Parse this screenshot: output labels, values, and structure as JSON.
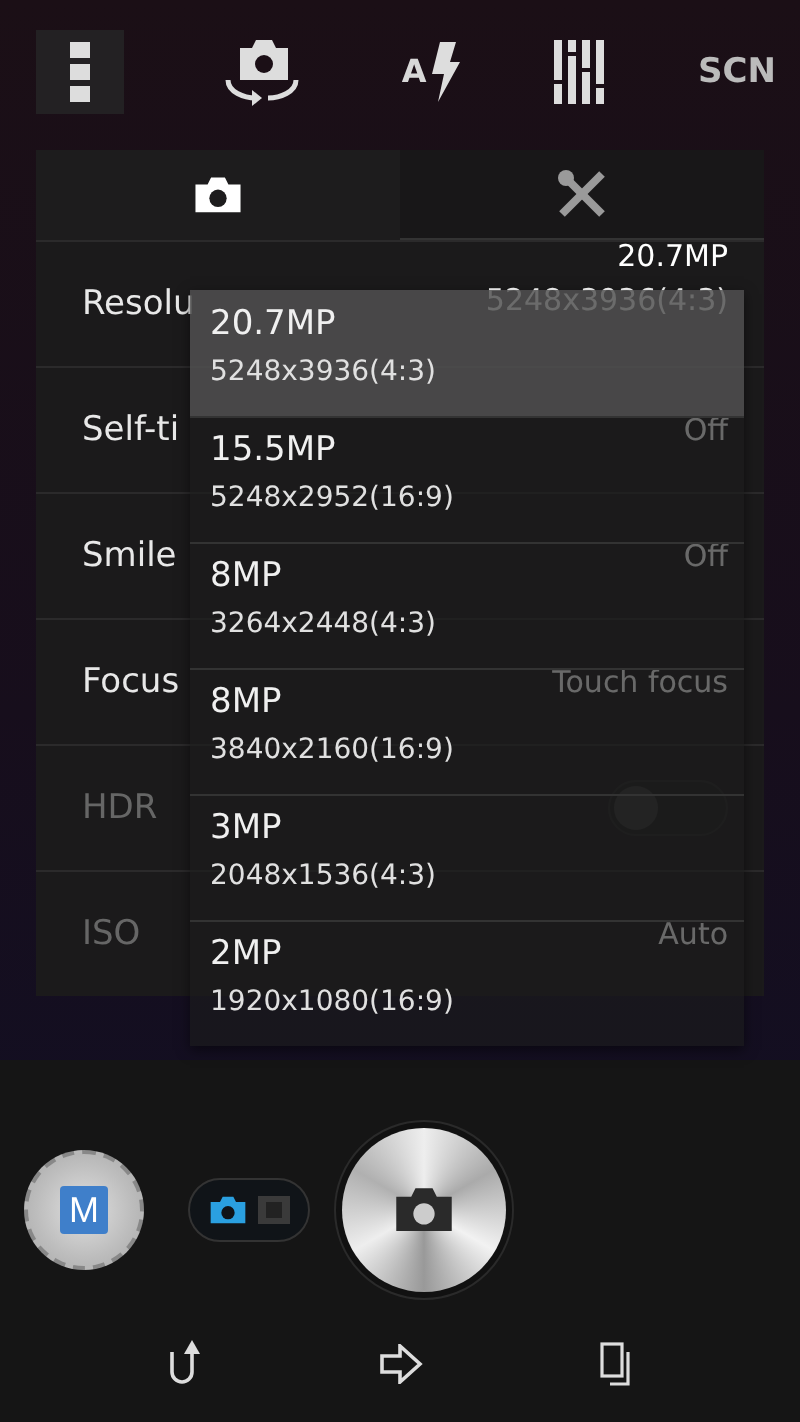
{
  "toolbar": {
    "flash_label": "A",
    "scene_label": "SCN"
  },
  "tabs": [
    {
      "kind": "camera",
      "selected": true
    },
    {
      "kind": "tools",
      "selected": false
    }
  ],
  "settings": [
    {
      "label": "Resolu",
      "value": "20.7MP",
      "value_detail": "5248x3936(4:3)",
      "disabled": false,
      "kind": "text"
    },
    {
      "label": "Self-ti",
      "value": "Off",
      "disabled": false,
      "kind": "text"
    },
    {
      "label": "Smile",
      "value": "Off",
      "disabled": false,
      "kind": "text"
    },
    {
      "label": "Focus",
      "value": "Touch focus",
      "disabled": false,
      "kind": "text"
    },
    {
      "label": "HDR",
      "disabled": true,
      "kind": "toggle",
      "on": false
    },
    {
      "label": "ISO",
      "value": "Auto",
      "disabled": true,
      "kind": "text"
    }
  ],
  "resolution_menu": [
    {
      "title": "20.7MP",
      "detail": "5248x3936(4:3)",
      "selected": true
    },
    {
      "title": "15.5MP",
      "detail": "5248x2952(16:9)",
      "selected": false
    },
    {
      "title": "8MP",
      "detail": "3264x2448(4:3)",
      "selected": false
    },
    {
      "title": "8MP",
      "detail": "3840x2160(16:9)",
      "selected": false
    },
    {
      "title": "3MP",
      "detail": "2048x1536(4:3)",
      "selected": false
    },
    {
      "title": "2MP",
      "detail": "1920x1080(16:9)",
      "selected": false
    }
  ],
  "controls": {
    "mode_label": "M",
    "photo_mode": true
  }
}
